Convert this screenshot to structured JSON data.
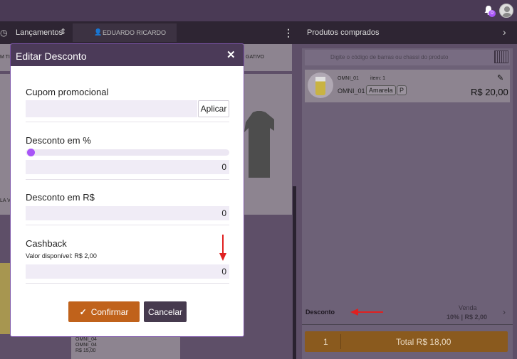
{
  "topbar": {
    "notification_count": "0"
  },
  "secbar": {
    "launches_label": "Lançamentos",
    "user_name": "EDUARDO RICARDO"
  },
  "products_panel": {
    "title": "Produtos comprados",
    "search_placeholder": "Digite o código de barras ou chassi do produto",
    "item": {
      "code": "OMNI_01",
      "item_label": "item: 1",
      "name": "OMNI_01",
      "color_tag": "Amarela",
      "size_tag": "P",
      "price": "R$ 20,00"
    },
    "discount_label": "Desconto",
    "sale_label": "Venda",
    "sale_value": "10% | R$ 2,00",
    "quantity": "1",
    "total": "Total R$ 18,00"
  },
  "background": {
    "card1_left": "M TI",
    "card1_right": "GATIVO",
    "card2_left": "LA V",
    "card3_lines": [
      "OMNI_04",
      "OMNI_04",
      "R$ 15,00"
    ]
  },
  "modal": {
    "title": "Editar Desconto",
    "coupon_label": "Cupom promocional",
    "coupon_value": "",
    "apply_button": "Aplicar",
    "percent_label": "Desconto em %",
    "percent_slider_value": 0,
    "percent_value": "0",
    "amount_label": "Desconto em R$",
    "amount_value": "0",
    "cashback_label": "Cashback",
    "cashback_available": "Valor disponível: R$ 2,00",
    "cashback_value": "0",
    "confirm_button": "Confirmar",
    "cancel_button": "Cancelar"
  },
  "colors": {
    "accent": "#a855f7",
    "confirm": "#c0621b",
    "cancel": "#463a4e",
    "header": "#4b3a58",
    "annotation_arrow": "#e02020"
  }
}
